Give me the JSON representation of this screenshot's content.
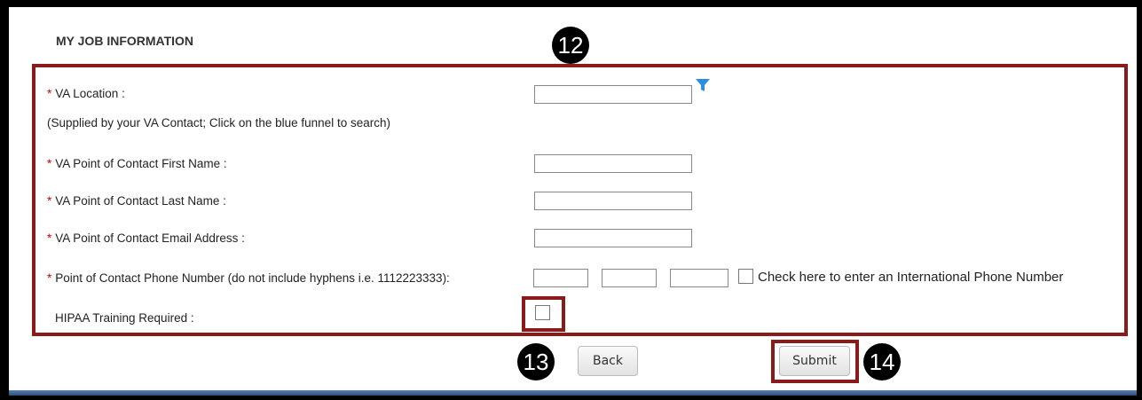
{
  "section": {
    "title": "MY JOB INFORMATION"
  },
  "callouts": {
    "form": "12",
    "back": "13",
    "submit": "14"
  },
  "required_marker": "*",
  "form": {
    "va_location": {
      "label": "VA Location   :",
      "value": "",
      "hint": "(Supplied by your VA Contact; Click on the blue funnel to search)",
      "filter_icon": "filter-funnel-icon"
    },
    "poc_first_name": {
      "label": "VA Point of Contact First Name   :",
      "value": ""
    },
    "poc_last_name": {
      "label": "VA Point of Contact Last Name   :",
      "value": ""
    },
    "poc_email": {
      "label": "VA Point of Contact Email Address   :",
      "value": ""
    },
    "poc_phone": {
      "label": "Point of Contact Phone Number (do not include hyphens i.e. 1112223333):",
      "area_code": "",
      "prefix": "",
      "line_number": "",
      "international_label": "Check here to enter an International Phone Number",
      "international_checked": false
    },
    "hipaa": {
      "label": "HIPAA Training Required :",
      "checked": false
    }
  },
  "buttons": {
    "back": "Back",
    "submit": "Submit"
  },
  "colors": {
    "highlight": "#8b1a1a",
    "required": "#cc0000",
    "funnel": "#2a8fe0",
    "bottom_strip": "#3d6591"
  }
}
